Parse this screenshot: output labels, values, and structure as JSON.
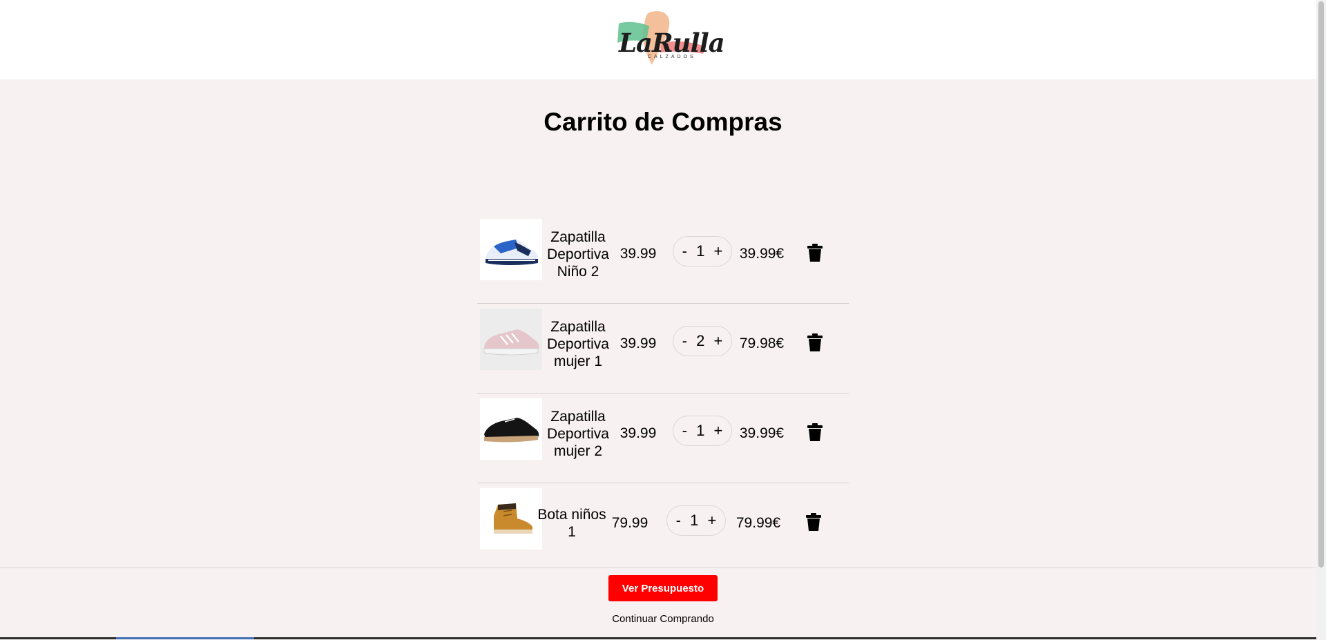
{
  "header": {
    "logo_text": "LaRulla",
    "logo_sub": "CALZADOS"
  },
  "page_title": "Carrito de Compras",
  "cart": {
    "items": [
      {
        "name": "Zapatilla Deportiva Niño 2",
        "price": "39.99",
        "qty": "1",
        "subtotal": "39.99€",
        "image": "blue-white-sneaker"
      },
      {
        "name": "Zapatilla Deportiva mujer 1",
        "price": "39.99",
        "qty": "2",
        "subtotal": "79.98€",
        "image": "pink-sneaker"
      },
      {
        "name": "Zapatilla Deportiva mujer 2",
        "price": "39.99",
        "qty": "1",
        "subtotal": "39.99€",
        "image": "black-suede-sneaker"
      },
      {
        "name": "Bota niños 1",
        "price": "79.99",
        "qty": "1",
        "subtotal": "79.99€",
        "image": "tan-boot"
      }
    ],
    "minus_label": "-",
    "plus_label": "+"
  },
  "footer": {
    "budget_button": "Ver Presupuesto",
    "continue_link": "Continuar Comprando"
  },
  "colors": {
    "background": "#f8f1f1",
    "accent": "#ff0000"
  }
}
